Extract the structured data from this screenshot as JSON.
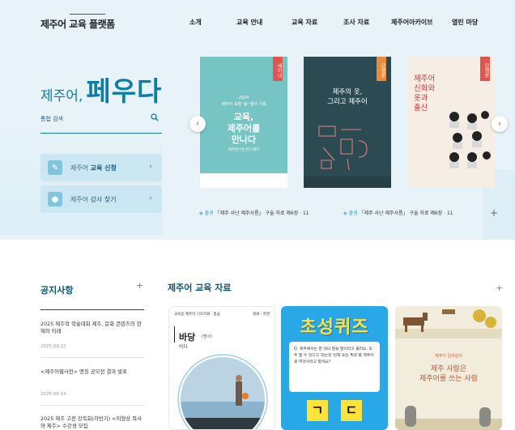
{
  "header": {
    "logo": "제주어 교육 플랫폼",
    "nav": [
      "소개",
      "교육 안내",
      "교육 자료",
      "조사 자료",
      "제주어아카이브",
      "열린 마당"
    ]
  },
  "hero": {
    "brand_small": "제주어,",
    "brand_big": "페우다",
    "search_placeholder": "통합 검색",
    "quick": [
      {
        "pre": "제주어 ",
        "bold": "교육 신청"
      },
      {
        "pre": "제주어 ",
        "bold": "강사 찾기"
      }
    ]
  },
  "books": [
    {
      "tag": "세미나",
      "line1": "2024",
      "line2": "제주어 포럼 '숲' 행사 기록",
      "title": "교육,\n제주어를\n만나다",
      "sub": "제주연구원 연구센터"
    },
    {
      "tag": "단행본",
      "line1": "",
      "line2": "",
      "title": "제주의 옷,\n그리고 제주어",
      "sub": ""
    },
    {
      "tag": "단행본",
      "line1": "",
      "line2": "",
      "title": "제주어\n신화와\n옷과\n출산",
      "sub": ""
    }
  ],
  "captions": [
    "「제주 사난 제주사름」 구술 자료 제6장 · 11",
    "「제주 사난 제주사름」 구술 자료 제6장 · 11"
  ],
  "caption_tag": "출생",
  "notice": {
    "title": "공지사항",
    "items": [
      {
        "title": "2025 제주학 학술대회 제주, 문화 콘텐츠의 현재와 미래",
        "date": "2025.09.12"
      },
      {
        "title": "<제주어웹사전> 명칭 공모전 결과 발표",
        "date": "2025.08.14"
      },
      {
        "title": "2025 제주 고전 강독회(하반기) <이형상 목사와 제주> 수강생 모집",
        "date": ""
      }
    ]
  },
  "materials": {
    "title": "제주어 교육 자료",
    "card1": {
      "head": "교육용 제주어 기초어휘 · 총곱",
      "tag": "회화 · 자연",
      "word": "바당",
      "pos": "(명사)",
      "meaning": "바다"
    },
    "card2": {
      "title": "초성퀴즈",
      "question": "Q. 제주에서는 한 대의 말을 말이라고 불러요. 오두 말 수 있다고 하는데 '왼쪽 또는 튀후'를 제주어로 무엇이라고 할까요?",
      "letters": [
        "ㄱ",
        "ㄷ"
      ]
    },
    "card3": {
      "head": "제주어 길라잡이",
      "title": "제주 사람은\n제주어를 쓰는 사람"
    }
  },
  "colors": {
    "accent": "#0e7ea3",
    "hero_bg": "#e7f3f9"
  }
}
